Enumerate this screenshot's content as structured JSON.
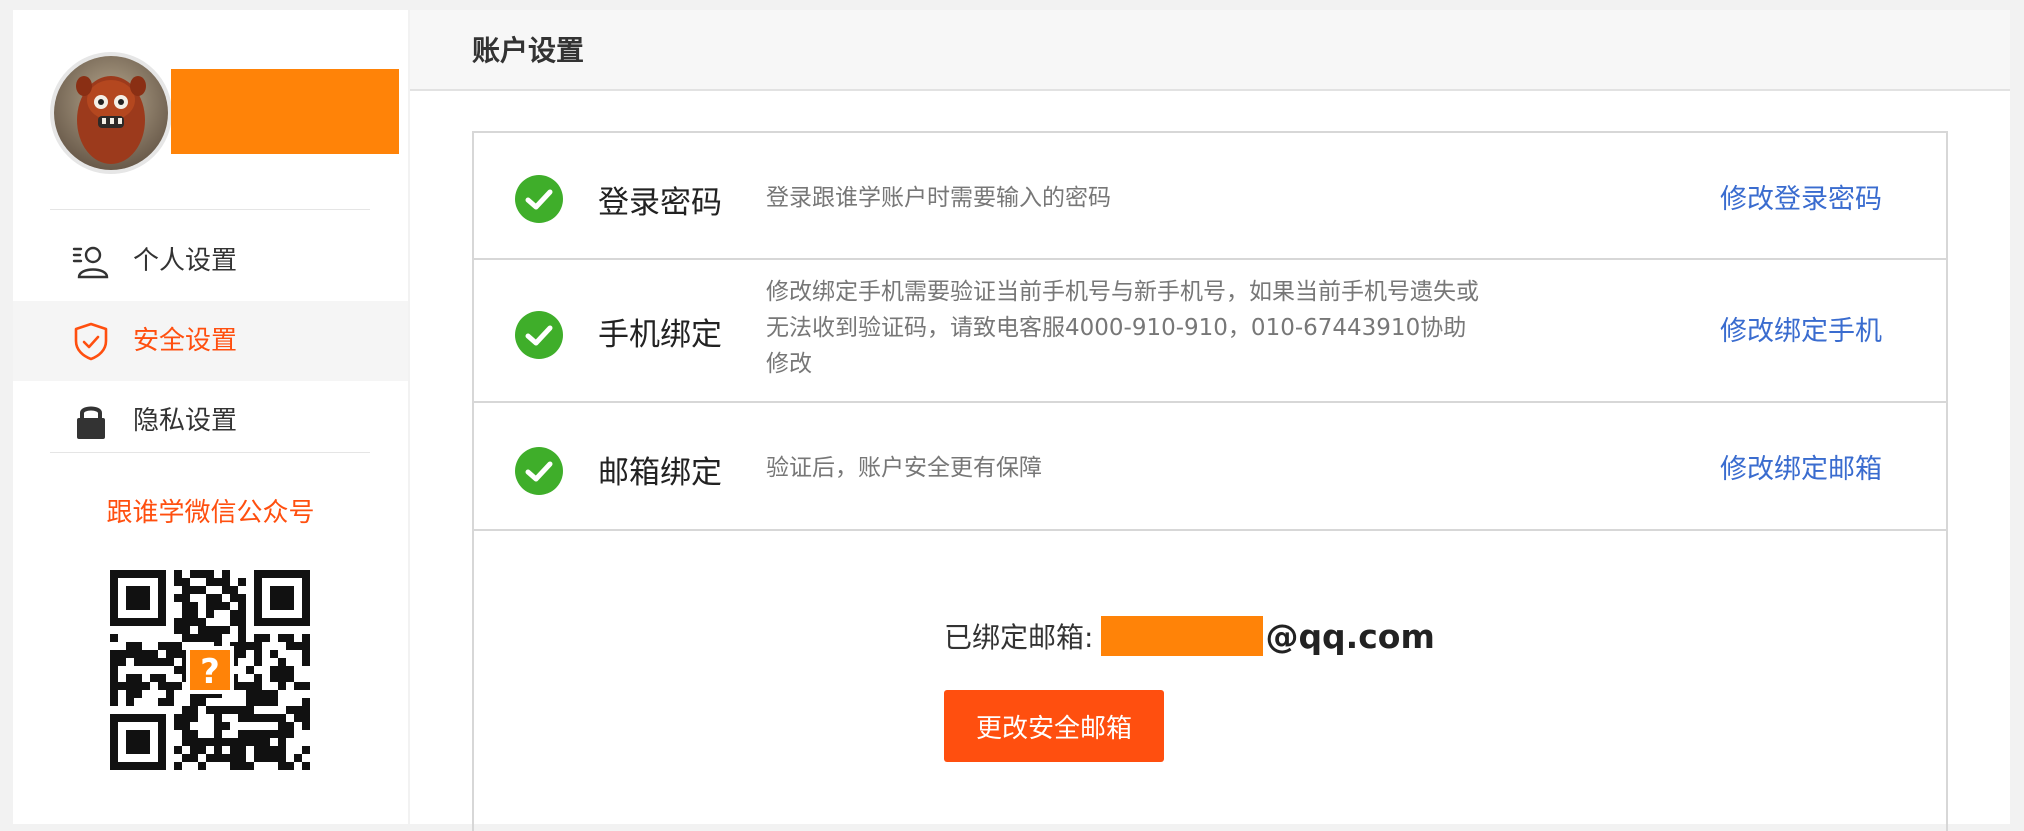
{
  "sidebar": {
    "items": [
      {
        "label": "个人设置",
        "icon": "person-icon",
        "active": false
      },
      {
        "label": "安全设置",
        "icon": "shield-check-icon",
        "active": true
      },
      {
        "label": "隐私设置",
        "icon": "lock-icon",
        "active": false
      }
    ],
    "wechat_title": "跟谁学微信公众号"
  },
  "main": {
    "title": "账户设置",
    "rows": [
      {
        "label": "登录密码",
        "description": "登录跟谁学账户时需要输入的密码",
        "action": "修改登录密码"
      },
      {
        "label": "手机绑定",
        "description": "修改绑定手机需要验证当前手机号与新手机号，如果当前手机号遗失或无法收到验证码，请致电客服4000-910-910，010-67443910协助修改",
        "action": "修改绑定手机"
      },
      {
        "label": "邮箱绑定",
        "description": "验证后，账户安全更有保障",
        "action": "修改绑定邮箱"
      }
    ],
    "bound_email_label": "已绑定邮箱:",
    "bound_email_domain": "@qq.com",
    "change_email_button": "更改安全邮箱"
  },
  "colors": {
    "accent": "#ff4f0f",
    "link": "#3a6ccf",
    "check_green": "#3fae2a",
    "redaction": "#ff8308"
  }
}
